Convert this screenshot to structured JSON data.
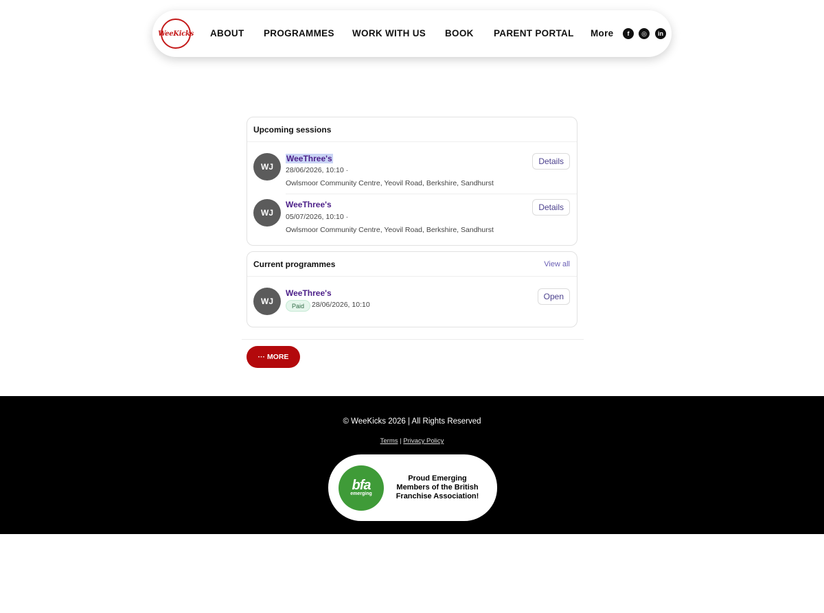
{
  "header": {
    "logo_text": "WeeKicks",
    "nav": [
      "ABOUT",
      "PROGRAMMES",
      "WORK WITH US",
      "BOOK",
      "PARENT PORTAL",
      "More"
    ],
    "social": [
      {
        "name": "facebook-icon",
        "glyph": "f"
      },
      {
        "name": "instagram-icon",
        "glyph": "◎"
      },
      {
        "name": "linkedin-icon",
        "glyph": "in"
      }
    ]
  },
  "upcoming": {
    "title": "Upcoming sessions",
    "items": [
      {
        "avatar": "WJ",
        "title": "WeeThree's",
        "date": "28/06/2026, 10:10  ·",
        "location": "Owlsmoor Community Centre, Yeovil Road, Berkshire, Sandhurst",
        "button": "Details"
      },
      {
        "avatar": "WJ",
        "title": "WeeThree's",
        "date": "05/07/2026, 10:10  ·",
        "location": "Owlsmoor Community Centre, Yeovil Road, Berkshire, Sandhurst",
        "button": "Details"
      }
    ]
  },
  "current": {
    "title": "Current programmes",
    "view_all": "View all",
    "items": [
      {
        "avatar": "WJ",
        "title": "WeeThree's",
        "badge": "Paid",
        "date": "28/06/2026, 10:10",
        "button": "Open"
      }
    ]
  },
  "more_button": "··· MORE",
  "footer": {
    "copyright": "© WeeKicks 2026 | All Rights Reserved",
    "terms": "Terms",
    "separator": "|",
    "privacy": "Privacy Policy",
    "bfa_letters": "bfa",
    "bfa_small": "emerging",
    "bfa_message": "Proud Emerging Members of the British Franchise Association!"
  },
  "colors": {
    "brand_red": "#b3090c",
    "title_purple": "#4b1e88",
    "bfa_green": "#3f9b38"
  }
}
